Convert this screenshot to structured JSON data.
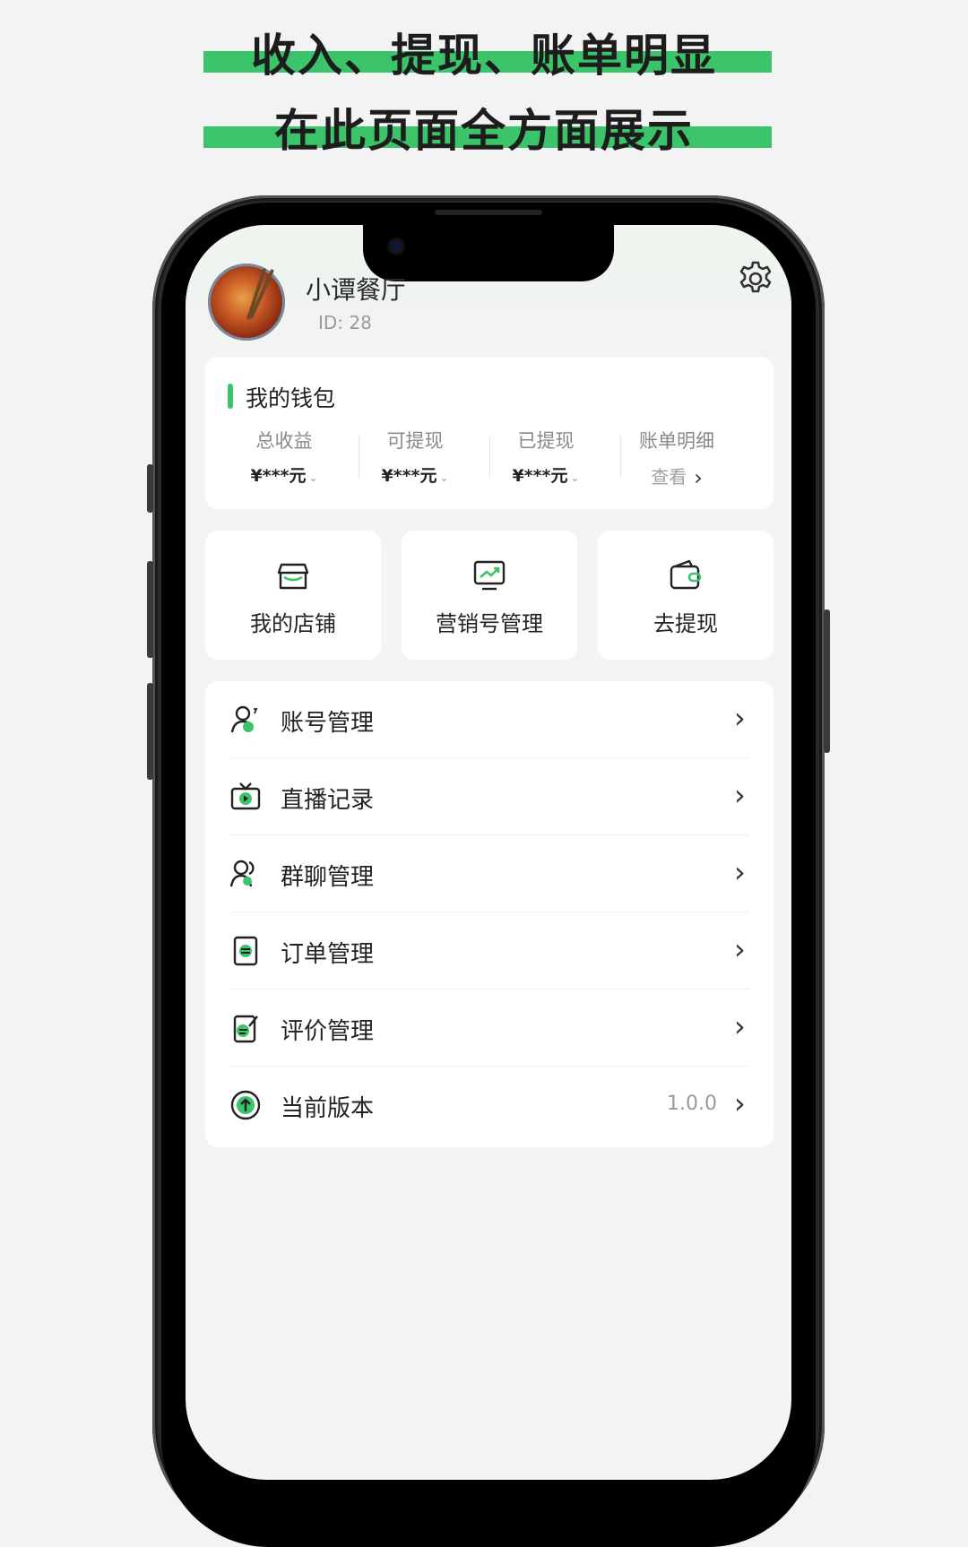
{
  "promo": {
    "line1": "收入、提现、账单明显",
    "line2": "在此页面全方面展示",
    "accent_color": "#3cc46a"
  },
  "profile": {
    "name": "小谭餐厅",
    "id_text": "ID: 28",
    "settings_icon": "gear-icon"
  },
  "wallet": {
    "title": "我的钱包",
    "stats": [
      {
        "label": "总收益",
        "value": "¥***元"
      },
      {
        "label": "可提现",
        "value": "¥***元"
      },
      {
        "label": "已提现",
        "value": "¥***元"
      }
    ],
    "bill": {
      "label": "账单明细",
      "link": "查看"
    }
  },
  "tiles": [
    {
      "label": "我的店铺",
      "icon": "store-icon"
    },
    {
      "label": "营销号管理",
      "icon": "monitor-trend-icon"
    },
    {
      "label": "去提现",
      "icon": "wallet-icon"
    }
  ],
  "menu": [
    {
      "label": "账号管理",
      "icon": "account-icon"
    },
    {
      "label": "直播记录",
      "icon": "live-tv-icon"
    },
    {
      "label": "群聊管理",
      "icon": "group-icon"
    },
    {
      "label": "订单管理",
      "icon": "order-icon"
    },
    {
      "label": "评价管理",
      "icon": "review-icon"
    },
    {
      "label": "当前版本",
      "icon": "upgrade-icon",
      "value": "1.0.0"
    }
  ]
}
